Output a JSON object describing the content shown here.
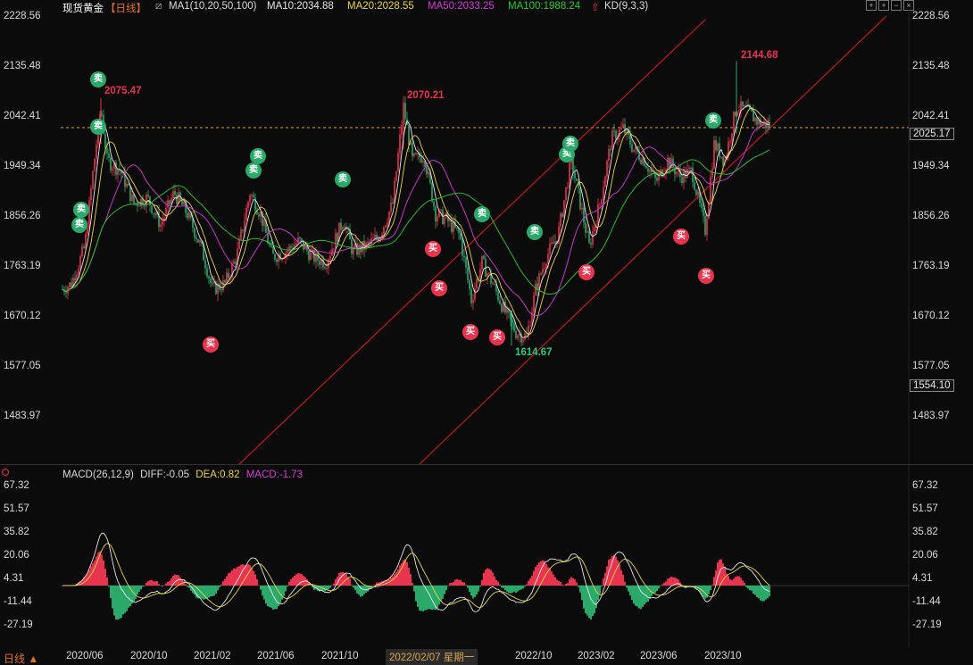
{
  "header": {
    "symbol": "现货黄金",
    "period": "【日线】",
    "ma_name": "MA1(10,20,50,100)",
    "ma10": "MA10:2034.88",
    "ma20": "MA20:2028.55",
    "ma50": "MA50:2033.25",
    "ma100": "MA100:1988.24",
    "kd": "KD(9,3,3)"
  },
  "colors": {
    "ma10": "#e6e6e6",
    "ma20": "#e8d44d",
    "ma50": "#d040d0",
    "ma100": "#2fc82f",
    "up": "#e8354f",
    "down": "#2aa96a",
    "channel": "#d62020",
    "dash": "#e0a040"
  },
  "price_axis": {
    "ticks": [
      "2228.56",
      "2135.48",
      "2042.41",
      "1949.34",
      "1856.26",
      "1763.19",
      "1670.12",
      "1577.05",
      "1483.97"
    ],
    "current_price": "2025.17",
    "low_box": "1554.10"
  },
  "annotations": {
    "high1": "2075.47",
    "high2": "2070.21",
    "high3": "2144.68",
    "low1": "1614.67"
  },
  "signals": {
    "sell": "卖",
    "buy": "买"
  },
  "macd": {
    "name": "MACD(26,12,9)",
    "diff": "DIFF:-0.05",
    "dea": "DEA:0.82",
    "macd": "MACD:-1.73",
    "ticks": [
      "67.32",
      "51.57",
      "35.82",
      "20.06",
      "4.31",
      "-11.44",
      "-27.19"
    ]
  },
  "time_axis": {
    "labels": [
      "2020/06",
      "2020/10",
      "2021/02",
      "2021/06",
      "2021/10",
      "2022/10",
      "2023/02",
      "2023/06",
      "2023/10"
    ],
    "crosshair_date": "2022/02/07 星期一",
    "period_button": "日线 ▲"
  },
  "chart_data": {
    "type": "line",
    "title": "",
    "series": [
      {
        "name": "MA10",
        "values": [
          1720,
          1760,
          1960,
          1900,
          1860,
          1700,
          1850,
          1790,
          1810,
          1800,
          1900,
          1860,
          1720,
          1690,
          1640,
          1800,
          1940,
          1880,
          2000,
          1940,
          1930,
          1880,
          2030,
          2010,
          2034.88
        ]
      },
      {
        "name": "MA20",
        "values": [
          1715,
          1750,
          1930,
          1900,
          1860,
          1720,
          1830,
          1800,
          1805,
          1800,
          1880,
          1860,
          1740,
          1700,
          1660,
          1780,
          1920,
          1880,
          1980,
          1940,
          1920,
          1890,
          2000,
          2010,
          2028.55
        ]
      },
      {
        "name": "MA50",
        "values": [
          1700,
          1730,
          1900,
          1880,
          1860,
          1750,
          1800,
          1810,
          1800,
          1800,
          1850,
          1860,
          1780,
          1720,
          1690,
          1730,
          1880,
          1880,
          1950,
          1930,
          1920,
          1900,
          1980,
          2000,
          2033.25
        ]
      },
      {
        "name": "MA100",
        "values": [
          1640,
          1700,
          1860,
          1890,
          1870,
          1800,
          1790,
          1800,
          1800,
          1800,
          1820,
          1850,
          1810,
          1770,
          1720,
          1700,
          1800,
          1860,
          1900,
          1920,
          1920,
          1910,
          1950,
          1960,
          1988.24
        ]
      }
    ],
    "ylim": [
      1483.97,
      2228.56
    ]
  }
}
